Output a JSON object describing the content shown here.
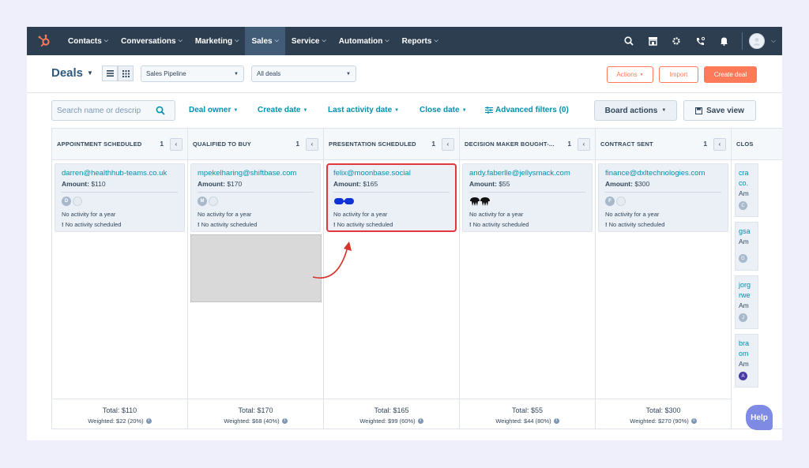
{
  "nav": {
    "items": [
      {
        "label": "Contacts",
        "active": false
      },
      {
        "label": "Conversations",
        "active": false
      },
      {
        "label": "Marketing",
        "active": false
      },
      {
        "label": "Sales",
        "active": true
      },
      {
        "label": "Service",
        "active": false
      },
      {
        "label": "Automation",
        "active": false
      },
      {
        "label": "Reports",
        "active": false
      }
    ],
    "icons": [
      "search-icon",
      "marketplace-icon",
      "settings-gear-icon",
      "calling-icon",
      "notifications-bell-icon",
      "avatar-icon"
    ]
  },
  "header": {
    "title": "Deals",
    "pipeline": "Sales Pipeline",
    "view": "All deals",
    "actions_label": "Actions",
    "import_label": "Import",
    "create_label": "Create deal"
  },
  "filters": {
    "search_placeholder": "Search name or descrip",
    "deal_owner": "Deal owner",
    "create_date": "Create date",
    "last_activity": "Last activity date",
    "close_date": "Close date",
    "advanced": "Advanced filters (0)",
    "board_actions": "Board actions",
    "save_view": "Save view"
  },
  "columns": [
    {
      "title": "APPOINTMENT SCHEDULED",
      "count": "1",
      "card": {
        "name": "darren@healthhub-teams.co.uk",
        "amount_label": "Amount:",
        "amount": "$110",
        "avatar": "D",
        "activity": "No activity for a year",
        "schedule": "No activity scheduled"
      },
      "total": "Total: $110",
      "weighted": "Weighted: $22 (20%)"
    },
    {
      "title": "QUALIFIED TO BUY",
      "count": "1",
      "card": {
        "name": "mpekelharing@shiftbase.com",
        "amount_label": "Amount:",
        "amount": "$170",
        "avatar": "M",
        "activity": "No activity for a year",
        "schedule": "No activity scheduled"
      },
      "total": "Total: $170",
      "weighted": "Weighted: $68 (40%)"
    },
    {
      "title": "PRESENTATION SCHEDULED",
      "count": "1",
      "card": {
        "name": "felix@moonbase.social",
        "amount_label": "Amount:",
        "amount": "$165",
        "avatar": "",
        "activity": "No activity for a year",
        "schedule": "No activity scheduled"
      },
      "total": "Total: $165",
      "weighted": "Weighted: $99 (60%)"
    },
    {
      "title": "DECISION MAKER BOUGHT-...",
      "count": "1",
      "card": {
        "name": "andy.faberlle@jellysmack.com",
        "amount_label": "Amount:",
        "amount": "$55",
        "avatar": "",
        "activity": "No activity for a year",
        "schedule": "No activity scheduled"
      },
      "total": "Total: $55",
      "weighted": "Weighted: $44 (80%)"
    },
    {
      "title": "CONTRACT SENT",
      "count": "1",
      "card": {
        "name": "finance@dxltechnologies.com",
        "amount_label": "Amount:",
        "amount": "$300",
        "avatar": "F",
        "activity": "No activity for a year",
        "schedule": "No activity scheduled"
      },
      "total": "Total: $300",
      "weighted": "Weighted: $270 (90%)"
    }
  ],
  "closed_column": {
    "title": "CLOS",
    "cards": [
      {
        "line1": "cra",
        "line2": "co.",
        "amount": "Am",
        "avatar": "C"
      },
      {
        "line1": "gsa",
        "line2": "",
        "amount": "Am",
        "avatar": "G"
      },
      {
        "line1": "jorg",
        "line2": "rwe",
        "amount": "Am",
        "avatar": "J"
      },
      {
        "line1": "bra",
        "line2": "om",
        "amount": "Am",
        "avatar": "A"
      }
    ]
  },
  "help_label": "Help",
  "accent_colors": {
    "nav_bg": "#2d3e50",
    "link": "#0091ae",
    "orange": "#ff7a59",
    "highlight": "#e0383e"
  }
}
